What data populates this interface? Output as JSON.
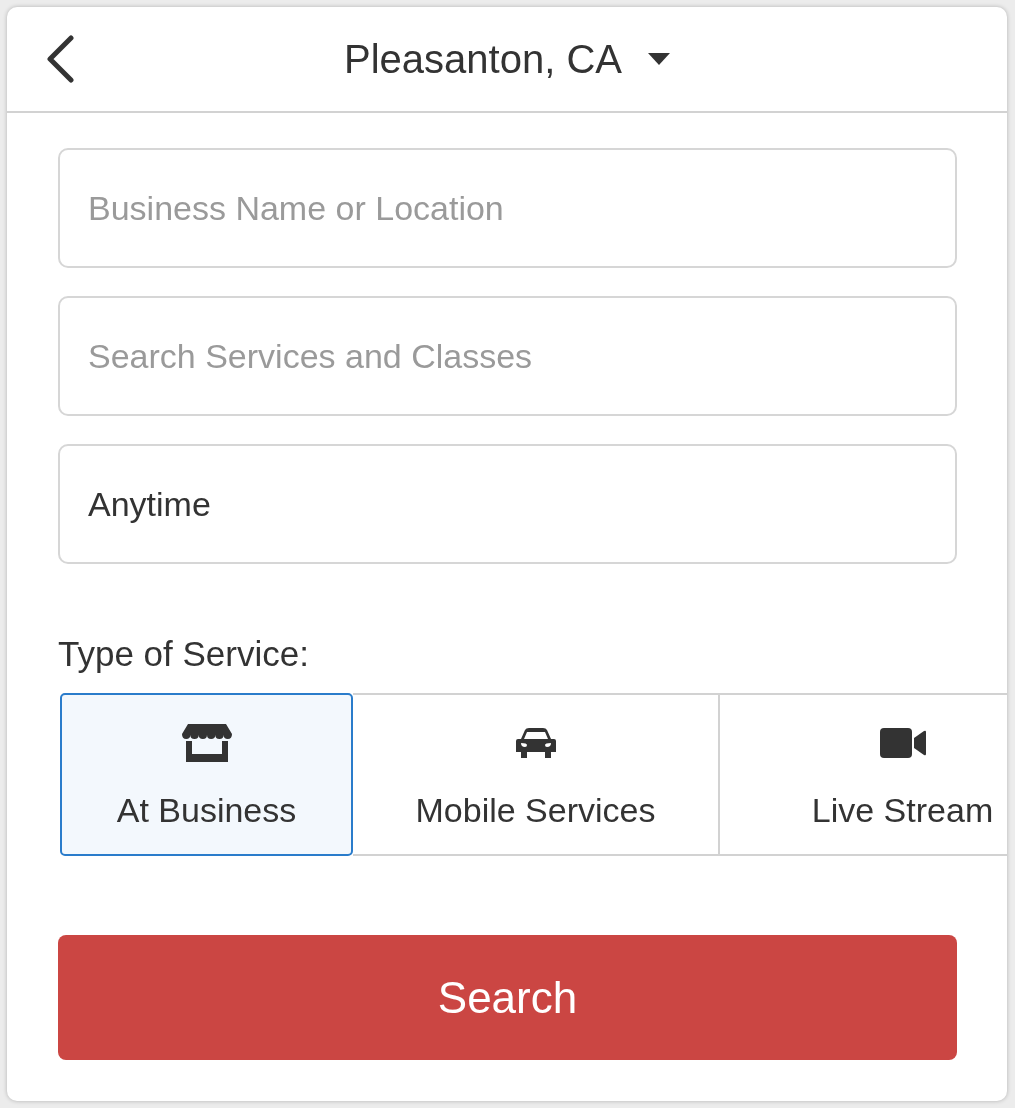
{
  "header": {
    "title": "Pleasanton, CA"
  },
  "fields": [
    {
      "kind": "text",
      "placeholder": "Business Name or Location"
    },
    {
      "kind": "text",
      "placeholder": "Search Services and Classes"
    },
    {
      "kind": "text",
      "value": "Anytime"
    }
  ],
  "service_type": {
    "label": "Type of Service:",
    "options": [
      {
        "kind": "in_person",
        "label": "At Business",
        "selected": true
      },
      {
        "kind": "mobile",
        "label": "Mobile Services",
        "selected": false
      },
      {
        "kind": "online",
        "label": "Live Stream",
        "selected": false
      }
    ]
  },
  "search_button": {
    "label": "Search"
  }
}
